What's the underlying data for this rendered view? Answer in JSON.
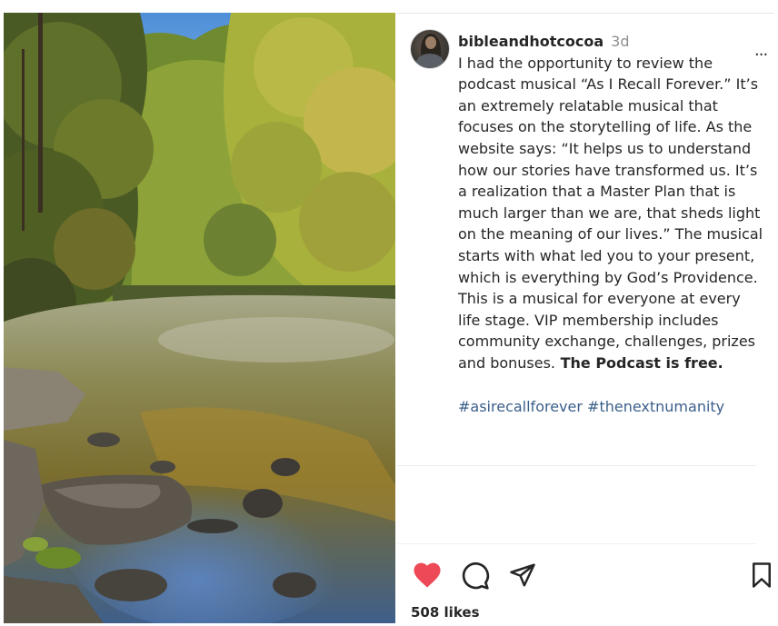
{
  "post": {
    "username": "bibleandhotcocoa",
    "time_ago": "3d",
    "caption_text": "I had the opportunity to review the podcast musical “As I Recall Forever.” It’s an extremely relatable musical that focuses on the storytelling of life. As the website says: “It helps us to understand how our stories have transformed us. It’s a realization that a Master Plan that is much larger than we are, that sheds light on the meaning of our lives.” The musical starts with what led you to your present, which is everything by God’s Providence. This is a musical for everyone at every life stage. VIP membership includes community exchange, challenges, prizes and bonuses.",
    "caption_bold": " The Podcast is free.",
    "hashtags": [
      "#asirecallforever",
      "#thenextnumanity"
    ],
    "likes": "508 likes"
  },
  "icons": {
    "avatar": "profile-avatar",
    "more": "more-options-icon",
    "like": "heart-filled-icon",
    "comment": "comment-bubble-icon",
    "share": "paper-plane-icon",
    "save": "bookmark-icon"
  },
  "colors": {
    "like_red": "#ed4956",
    "hashtag_blue": "#3b5f8a",
    "text": "#262626",
    "muted": "#8e8e8e"
  }
}
